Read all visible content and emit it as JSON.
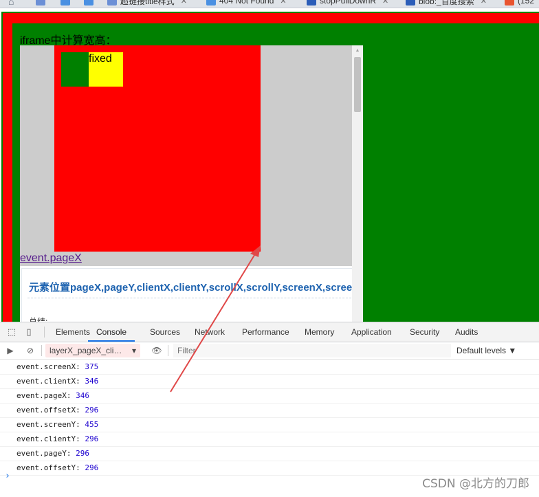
{
  "tabbar": {
    "tabs": [
      {
        "label": "超链接title样式",
        "favicon": "doc-icon",
        "color": "#6b8fd6"
      },
      {
        "label": "404 Not Found",
        "favicon": "csdn-icon",
        "color": "#4a90e2"
      },
      {
        "label": "stopPullDownR",
        "favicon": "baidu-paw-icon",
        "color": "#2b5db8"
      },
      {
        "label": "blob:_百度搜索",
        "favicon": "baidu-paw-icon",
        "color": "#2b5db8"
      },
      {
        "label": "(152",
        "favicon": "csdn-c-icon",
        "color": "#e9542f"
      }
    ]
  },
  "page": {
    "heading": "iframe中计算宽高：",
    "fixed_label": "fixed",
    "link_text": "event.pageX",
    "article_title": "元素位置pageX,pageY,clientX,clientY,scrollX,scrollY,screenX,screenY",
    "article_summary": "总结:"
  },
  "devtools": {
    "tabs": [
      "Elements",
      "Console",
      "Sources",
      "Network",
      "Performance",
      "Memory",
      "Application",
      "Security",
      "Audits"
    ],
    "active_tab": "Console",
    "context": "layerX_pageX_clientX",
    "filter_placeholder": "Filter",
    "levels": "Default levels ▼"
  },
  "console_logs": [
    {
      "key": "event.screenX:",
      "value": "375"
    },
    {
      "key": "event.clientX:",
      "value": "346"
    },
    {
      "key": "event.pageX:",
      "value": "346"
    },
    {
      "key": "event.offsetX:",
      "value": "296"
    },
    {
      "key": "event.screenY:",
      "value": "455"
    },
    {
      "key": "event.clientY:",
      "value": "296"
    },
    {
      "key": "event.pageY:",
      "value": "296"
    },
    {
      "key": "event.offsetY:",
      "value": "296"
    }
  ],
  "watermark": "CSDN @北方的刀郎",
  "colors": {
    "frame_red": "#ff0000",
    "frame_green": "#008000",
    "iframe_bg": "#cccccc",
    "highlight_yellow": "#ffff00",
    "annotation_arrow": "#e04848",
    "devtools_accent": "#1a73e8"
  }
}
